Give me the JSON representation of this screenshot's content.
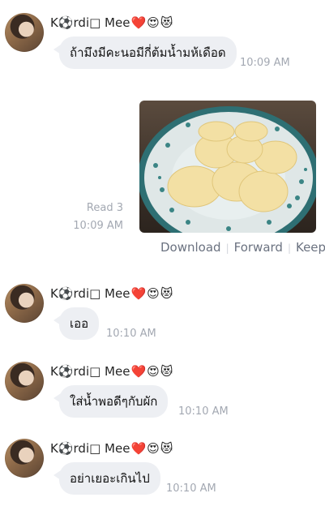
{
  "sender_name": "K⚽rdi□ Mee",
  "sender_emojis": [
    "❤️",
    "😍",
    "😻"
  ],
  "messages": [
    {
      "text": "ถ้ามึงมีคะนอมีกี่ต้มน้ำมห้เดือด",
      "time": "10:09 AM"
    },
    {
      "text": "เออ",
      "time": "10:10 AM"
    },
    {
      "text": "ใส่น้ำพอดีๆกับผัก",
      "time": "10:10 AM"
    },
    {
      "text": "อย่าเยอะเกินไป",
      "time": "10:10 AM"
    }
  ],
  "outgoing_image": {
    "read_label": "Read 3",
    "time": "10:09 AM",
    "actions": [
      "Download",
      "Forward",
      "Keep"
    ],
    "description_icon": "photo-icon"
  }
}
